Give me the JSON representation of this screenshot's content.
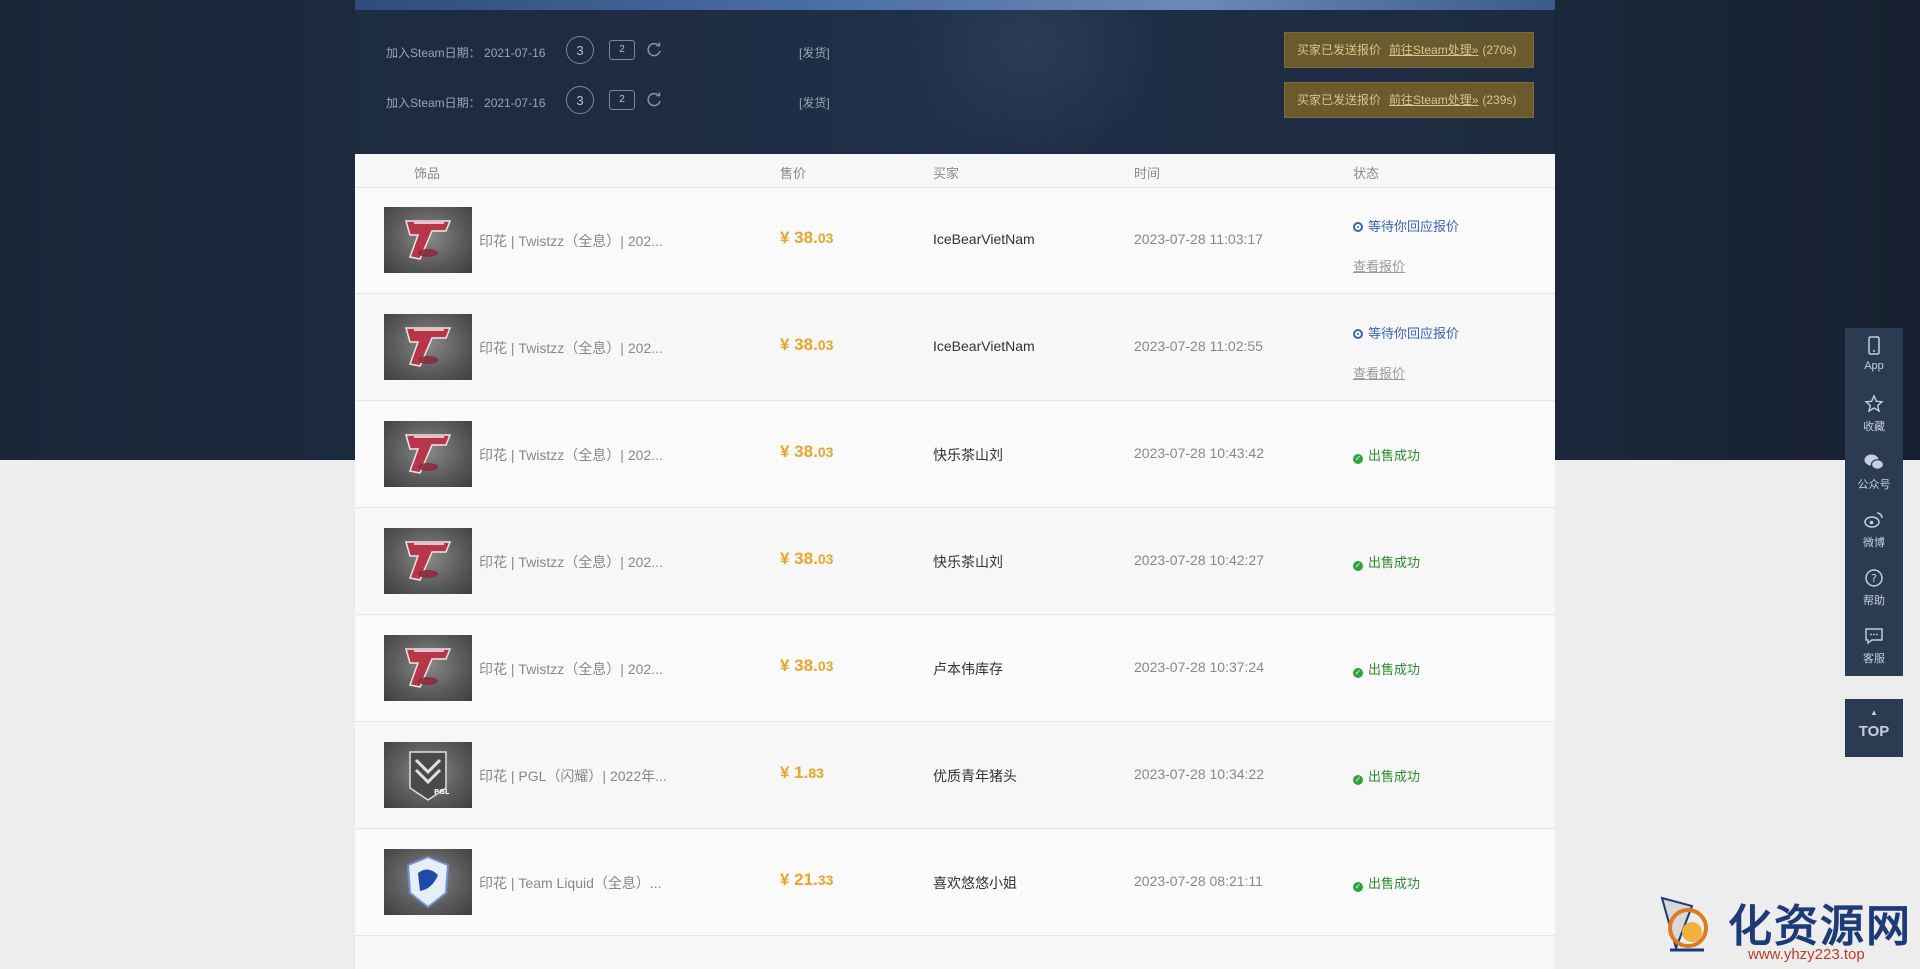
{
  "offers": [
    {
      "join_label": "加入Steam日期：",
      "join_date": "2021-07-16",
      "count": "3",
      "mini": "2",
      "ship_tag": "[发货]",
      "sent_label": "买家已发送报价",
      "goto_label": "前往Steam处理»",
      "timer": "(270s)"
    },
    {
      "join_label": "加入Steam日期：",
      "join_date": "2021-07-16",
      "count": "3",
      "mini": "2",
      "ship_tag": "[发货]",
      "sent_label": "买家已发送报价",
      "goto_label": "前往Steam处理»",
      "timer": "(239s)"
    }
  ],
  "table": {
    "headers": {
      "item": "饰品",
      "price": "售价",
      "buyer": "买家",
      "time": "时间",
      "status": "状态"
    },
    "view_offer_label": "查看报价",
    "rows": [
      {
        "name": "印花 | Twistzz（全息）| 202...",
        "price_int": "¥ 38.",
        "price_dec": "03",
        "buyer": "IceBearVietNam",
        "time": "2023-07-28 11:03:17",
        "status": "等待你回应报价",
        "status_type": "wait",
        "thumb": "faze"
      },
      {
        "name": "印花 | Twistzz（全息）| 202...",
        "price_int": "¥ 38.",
        "price_dec": "03",
        "buyer": "IceBearVietNam",
        "time": "2023-07-28 11:02:55",
        "status": "等待你回应报价",
        "status_type": "wait",
        "thumb": "faze"
      },
      {
        "name": "印花 | Twistzz（全息）| 202...",
        "price_int": "¥ 38.",
        "price_dec": "03",
        "buyer": "快乐茶山刘",
        "time": "2023-07-28 10:43:42",
        "status": "出售成功",
        "status_type": "ok",
        "thumb": "faze"
      },
      {
        "name": "印花 | Twistzz（全息）| 202...",
        "price_int": "¥ 38.",
        "price_dec": "03",
        "buyer": "快乐茶山刘",
        "time": "2023-07-28 10:42:27",
        "status": "出售成功",
        "status_type": "ok",
        "thumb": "faze"
      },
      {
        "name": "印花 | Twistzz（全息）| 202...",
        "price_int": "¥ 38.",
        "price_dec": "03",
        "buyer": "卢本伟库存",
        "time": "2023-07-28 10:37:24",
        "status": "出售成功",
        "status_type": "ok",
        "thumb": "faze"
      },
      {
        "name": "印花 | PGL（闪耀）| 2022年...",
        "price_int": "¥ 1.",
        "price_dec": "83",
        "buyer": "优质青年猪头",
        "time": "2023-07-28 10:34:22",
        "status": "出售成功",
        "status_type": "ok",
        "thumb": "pgl"
      },
      {
        "name": "印花 | Team Liquid（全息）...",
        "price_int": "¥ 21.",
        "price_dec": "33",
        "buyer": "喜欢悠悠小姐",
        "time": "2023-07-28 08:21:11",
        "status": "出售成功",
        "status_type": "ok",
        "thumb": "liquid"
      }
    ]
  },
  "sidebar": {
    "items": [
      {
        "label": "App",
        "icon": "phone-icon"
      },
      {
        "label": "收藏",
        "icon": "star-icon"
      },
      {
        "label": "公众号",
        "icon": "wechat-icon"
      },
      {
        "label": "微博",
        "icon": "weibo-icon"
      },
      {
        "label": "帮助",
        "icon": "help-icon"
      },
      {
        "label": "客服",
        "icon": "chat-icon"
      }
    ],
    "top_label": "TOP"
  },
  "watermark": {
    "text": "化资源网",
    "url": "www.yhzy223.top"
  },
  "colors": {
    "accent_price": "#e8a52a",
    "status_wait": "#3a63b8",
    "status_ok": "#2e8a2e",
    "sidebar_bg": "#2b3b52"
  }
}
